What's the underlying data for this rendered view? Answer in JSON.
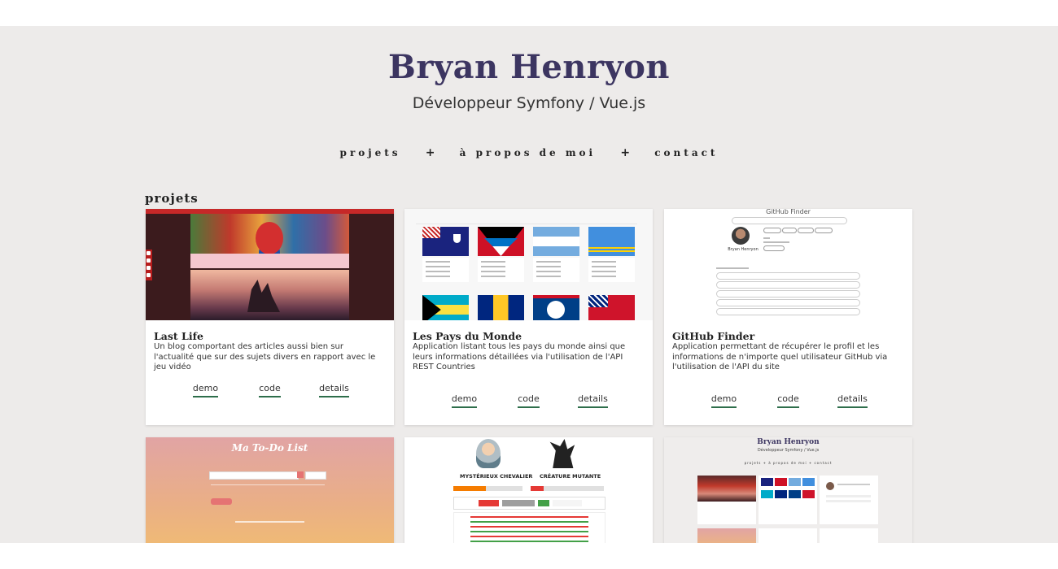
{
  "header": {
    "title": "Bryan Henryon",
    "subtitle": "Développeur Symfony / Vue.js"
  },
  "nav": {
    "items": [
      "projets",
      "à propos de moi",
      "contact"
    ],
    "separator": "+"
  },
  "section": {
    "title": "projets"
  },
  "projects": [
    {
      "title": "Last Life",
      "description": "Un blog comportant des articles aussi bien sur l'actualité que sur des sujets divers en rapport avec le jeu vidéo",
      "links": [
        "demo",
        "code",
        "details"
      ]
    },
    {
      "title": "Les Pays du Monde",
      "description": "Application listant tous les pays du monde ainsi que leurs informations détaillées via l'utilisation de l'API REST Countries",
      "links": [
        "demo",
        "code",
        "details"
      ]
    },
    {
      "title": "GitHub Finder",
      "description": "Application permettant de récupérer le profil et les informations de n'importe quel utilisateur GitHub via l'utilisation de l'API du site",
      "links": [
        "demo",
        "code",
        "details"
      ]
    }
  ],
  "thumbnails": {
    "github_title": "GitHub Finder",
    "github_user": "Bryan Henryon",
    "todo_title": "Ma To-Do List",
    "game_left": "MYSTÉRIEUX CHEVALIER",
    "game_right": "CRÉATURE MUTANTE",
    "portfolio_title": "Bryan Henryon",
    "portfolio_sub": "Développeur Symfony / Vue.js",
    "portfolio_nav": "projets + à propos de moi + contact"
  },
  "colors": {
    "title": "#3c3561",
    "background": "#edebea",
    "link_underline": "#2e6e4b"
  }
}
